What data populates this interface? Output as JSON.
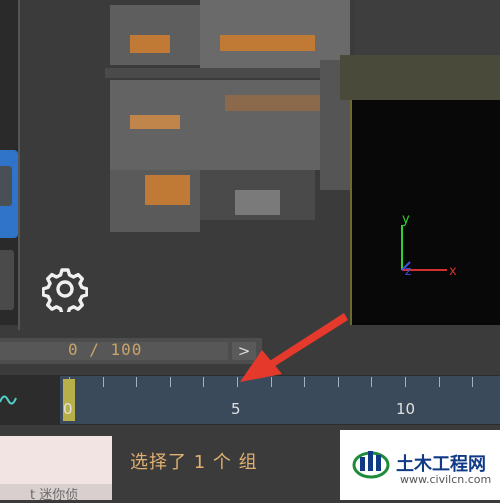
{
  "frame_counter": {
    "text": "0 / 100"
  },
  "next_frame_button": {
    "label": ">"
  },
  "timeline": {
    "ticks": [
      "0",
      "5",
      "10"
    ],
    "current_frame": 0
  },
  "status": {
    "selection_text": "选择了 1 个 组",
    "script_text": "t 迷你侦"
  },
  "viewport": {
    "axis_y": "y",
    "axis_z": "z",
    "axis_x": "x"
  },
  "watermark": {
    "title": "土木工程网",
    "url": "www.civilcn.com"
  },
  "colors": {
    "accent_orange": "#c8a46a",
    "timeline_track": "#3a4a5a",
    "time_slider": "#b7b04a",
    "annotation_arrow": "#e53a2b"
  }
}
